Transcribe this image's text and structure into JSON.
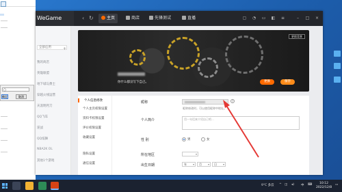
{
  "app": {
    "brand": "WeGame",
    "tabs": [
      {
        "label": "主页",
        "active": true,
        "icon": "home-icon"
      },
      {
        "label": "商店",
        "active": false,
        "icon": "store-icon"
      },
      {
        "label": "先锋测试",
        "active": false,
        "icon": "flask-icon"
      },
      {
        "label": "直播",
        "active": false,
        "icon": "tv-icon"
      }
    ],
    "accent": "#ff6a00"
  },
  "sidebar": {
    "search_label": "全部应用",
    "items": [
      "我的商店",
      "英雄联盟",
      "地下城与勇士",
      "穿越火线运营",
      "天涯明月刀",
      "QQ飞车",
      "逆战",
      "QQ炫舞",
      "NBA2K OL",
      "其他1个游戏"
    ]
  },
  "banner": {
    "bg_button": "更换背景",
    "signature": "你什么都没写下自己。",
    "buttons": [
      {
        "label": "更换",
        "color": "#ff6a00"
      },
      {
        "label": "保存",
        "color": "#ff8c1a"
      }
    ]
  },
  "subnav": {
    "items": [
      "个人信息修改",
      "个人主页权限设置",
      "资料卡权限设置",
      "评价权限设置",
      "收藏设置",
      "隐私设置",
      "通信设置"
    ],
    "active_index": 0
  },
  "form": {
    "nickname_label": "昵称",
    "nickname_hint": "昵称修改时，可以使用昵称中地址。",
    "intro_label": "个人简介",
    "intro_placeholder": "用一句话来介绍自己吧...",
    "gender_label": "性 别",
    "gender_male": "男",
    "gender_female": "女",
    "region_label": "所在地区",
    "birthday_label": "出生日期",
    "birthday_year": "年",
    "birthday_month": "月",
    "birthday_day": "日"
  },
  "dialog": {
    "ok": "确定",
    "cancel": "取消"
  },
  "taskbar": {
    "weather": "9°C 多云",
    "ime": "中",
    "time": "10:12",
    "date": "2022/12/8"
  },
  "colors": {
    "annotation_arrow": "#e53935",
    "topbar": "#24262b"
  }
}
